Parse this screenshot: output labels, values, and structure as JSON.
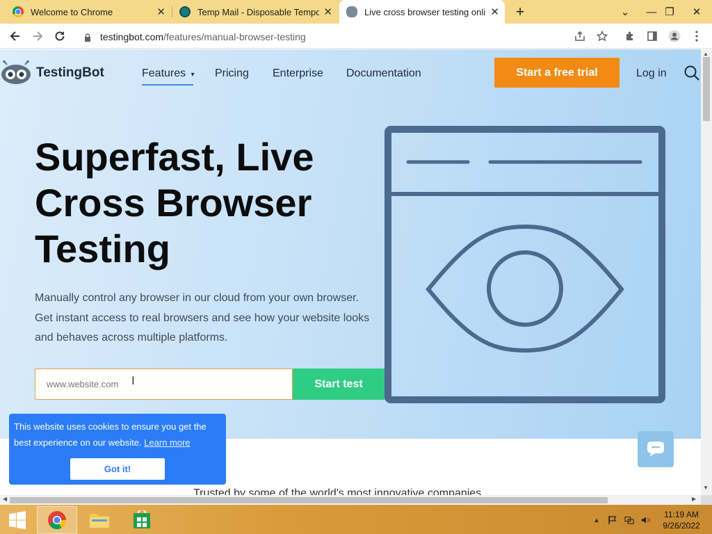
{
  "browser": {
    "tabs": [
      {
        "title": "Welcome to Chrome",
        "close": "✕"
      },
      {
        "title": "Temp Mail - Disposable Tempora",
        "close": "✕"
      },
      {
        "title": "Live cross browser testing online.",
        "close": "✕"
      }
    ],
    "new_tab": "+",
    "window_controls": {
      "dropdown": "⌄",
      "minimize": "—",
      "restore": "❐",
      "close": "✕"
    },
    "address": {
      "host": "testingbot.com",
      "path": "/features/manual-browser-testing"
    }
  },
  "page": {
    "brand": "TestingBot",
    "nav": {
      "features": "Features",
      "pricing": "Pricing",
      "enterprise": "Enterprise",
      "documentation": "Documentation",
      "trial": "Start a free trial",
      "login": "Log in"
    },
    "hero": {
      "headline": "Superfast, Live Cross Browser Testing",
      "subtext": "Manually control any browser in our cloud from your own browser. Get instant access to real browsers and see how your website looks and behaves across multiple platforms.",
      "input_placeholder": "www.website.com",
      "start_button": "Start test"
    },
    "trusted": "Trusted by some of the world's most innovative companies",
    "cookie": {
      "message": "This website uses cookies to ensure you get the best experience on our website.",
      "learn_more": "Learn more",
      "accept": "Got it!"
    }
  },
  "taskbar": {
    "time": "11:19 AM",
    "date": "9/26/2022"
  },
  "colors": {
    "accent_orange": "#f28a13",
    "accent_green": "#2fcd84",
    "cookie_blue": "#2b7cf6",
    "illustration": "#4a6a8e"
  }
}
